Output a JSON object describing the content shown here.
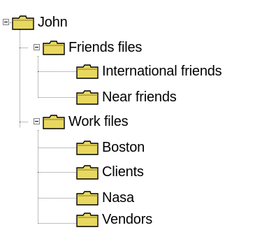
{
  "tree": {
    "root": {
      "label": "John",
      "expanded": true,
      "children": [
        {
          "label": "Friends files",
          "expanded": true,
          "children": [
            {
              "label": "International friends"
            },
            {
              "label": "Near friends"
            }
          ]
        },
        {
          "label": "Work files",
          "expanded": true,
          "children": [
            {
              "label": "Boston"
            },
            {
              "label": "Clients"
            },
            {
              "label": "Nasa"
            },
            {
              "label": "Vendors"
            }
          ]
        }
      ]
    },
    "icons": {
      "node_icon": "folder-icon",
      "expander_icon": "minus-box-icon"
    },
    "colors": {
      "folder_fill": "#e8d860",
      "folder_outline": "#000000",
      "connector": "#808080",
      "text": "#000000",
      "background": "#ffffff"
    }
  }
}
